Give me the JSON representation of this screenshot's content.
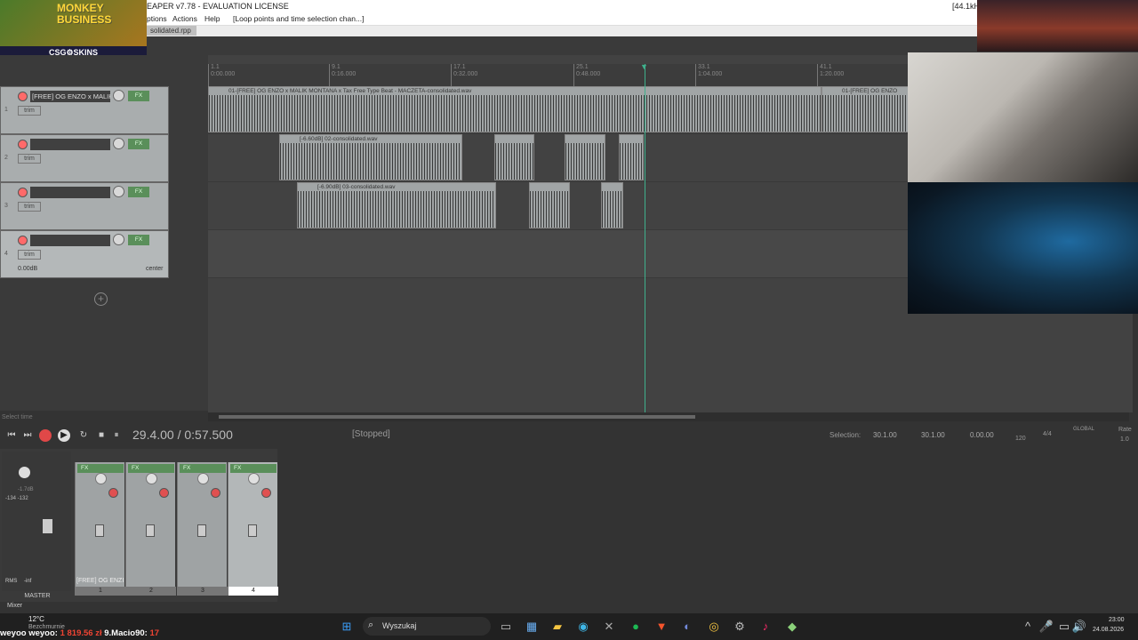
{
  "app": {
    "title": "EAPER v7.78 - EVALUATION LICENSE",
    "samplerate": "[44.1kHz"
  },
  "menu": {
    "items": [
      "ptions",
      "Actions",
      "Help"
    ],
    "status": "[Loop points and time selection chan...]"
  },
  "project_tab": "solidated.rpp",
  "overlay": {
    "game_logo": "MONKEY BUSINESS",
    "sponsor": "CSG⚙SKINS"
  },
  "ruler": {
    "labels": [
      {
        "bar": "1.1",
        "time": "0:00.000"
      },
      {
        "bar": "9.1",
        "time": "0:16.000"
      },
      {
        "bar": "17.1",
        "time": "0:32.000"
      },
      {
        "bar": "25.1",
        "time": "0:48.000"
      },
      {
        "bar": "33.1",
        "time": "1:04.000"
      },
      {
        "bar": "41.1",
        "time": "1:20.000"
      }
    ]
  },
  "tracks": [
    {
      "num": "1",
      "name": "[FREE] OG ENZO x MALIK",
      "trim": "trim"
    },
    {
      "num": "2",
      "name": "",
      "trim": "trim"
    },
    {
      "num": "3",
      "name": "",
      "trim": "trim"
    },
    {
      "num": "4",
      "name": "",
      "trim": "trim",
      "vol": "0.00dB",
      "pan": "center"
    }
  ],
  "items": {
    "t1": "01-[FREE] OG ENZO x MALIK MONTANA x Tax Free Type Beat - MACZETA-consolidated.wav",
    "t1b": "01-[FREE] OG ENZO",
    "t2": "[-6.60dB] 02-consolidated.wav",
    "t3": "[-6.90dB] 03-consolidated.wav"
  },
  "transport": {
    "time": "29.4.00 / 0:57.500",
    "state": "[Stopped]",
    "selection_label": "Selection:",
    "sel_start": "30.1.00",
    "sel_end": "30.1.00",
    "sel_len": "0.00.00",
    "bpm": "120",
    "sig": "4/4",
    "global": "GLOBAL",
    "rate": "Rate",
    "rate_val": "1.0",
    "select_time": "Select time"
  },
  "mixer": {
    "master": "MASTER",
    "rms": "RMS",
    "inf": "-inf",
    "master_db": "-1.7dB",
    "peaks": "-134  -132",
    "strip_labels": [
      "1",
      "2",
      "3",
      "4"
    ],
    "strip1_name": "[FREE] OG ENZI",
    "fx": "FX",
    "tab": "Mixer"
  },
  "taskbar": {
    "search": "Wyszukaj",
    "weather_temp": "12°C",
    "weather_text": "Bezchmurnie",
    "time": "23:00",
    "date": "24.08.2026"
  },
  "ticker": {
    "a": "weyoo weyoo:",
    "b": "1 819.56 zł",
    "c": "9.Macio90:",
    "d": "17"
  }
}
